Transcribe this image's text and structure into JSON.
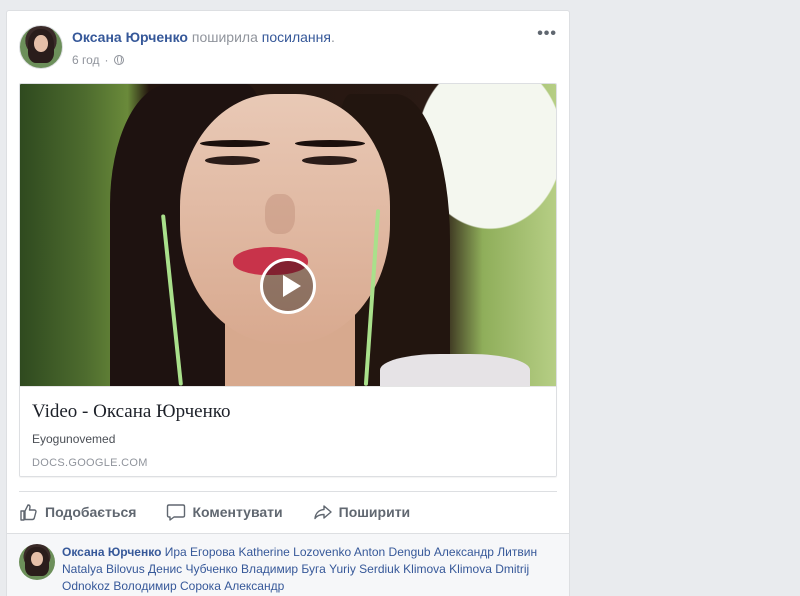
{
  "post": {
    "author": "Оксана Юрченко",
    "action_text": "поширила",
    "link_word": "посилання",
    "period": ".",
    "time": "6 год",
    "separator": "·",
    "more_icon": "more-horizontal-icon",
    "privacy_icon": "globe-icon"
  },
  "link_card": {
    "title": "Video - Оксана Юрченко",
    "description": "Eyogunovemed",
    "domain": "DOCS.GOOGLE.COM",
    "play_icon": "play-icon"
  },
  "actions": {
    "like": {
      "label": "Подобається",
      "icon": "thumbs-up-icon"
    },
    "comment": {
      "label": "Коментувати",
      "icon": "comment-icon"
    },
    "share": {
      "label": "Поширити",
      "icon": "share-icon"
    }
  },
  "likes": {
    "first_name": "Оксана Юрченко",
    "others": "Ира Егорова Katherine Lozovenko Anton Dengub Александр Литвин Natalya Bilovus Денис Чубченко Владимир Буга Yuriy Serdiuk Klimova Klimova Dmitrij Odnokoz Володимир Сорока Александр"
  },
  "colors": {
    "link_blue": "#365899",
    "muted_gray": "#90949c",
    "background": "#e9ebee"
  }
}
